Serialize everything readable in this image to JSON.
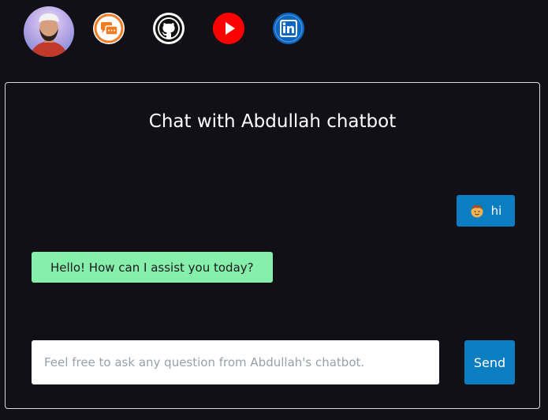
{
  "header": {
    "avatar_alt": "profile-photo",
    "links": [
      {
        "name": "chat",
        "icon": "chat-bubbles-icon",
        "color": "#f47b20"
      },
      {
        "name": "github",
        "icon": "github-icon",
        "color": "#000000"
      },
      {
        "name": "youtube",
        "icon": "youtube-icon",
        "color": "#ff0000"
      },
      {
        "name": "linkedin",
        "icon": "linkedin-icon",
        "color": "#0a66c2"
      }
    ]
  },
  "chat": {
    "title": "Chat with Abdullah chatbot",
    "messages": [
      {
        "role": "user",
        "text": "hi",
        "icon": "boy-emoji-icon"
      },
      {
        "role": "bot",
        "text": "Hello! How can I assist you today?"
      }
    ],
    "input": {
      "value": "",
      "placeholder": "Feel free to ask any question from Abdullah's chatbot."
    },
    "send_label": "Send"
  },
  "colors": {
    "background": "#111017",
    "user_bubble": "#0b7ec2",
    "bot_bubble": "#86efac",
    "send_button": "#0b7ec2"
  }
}
